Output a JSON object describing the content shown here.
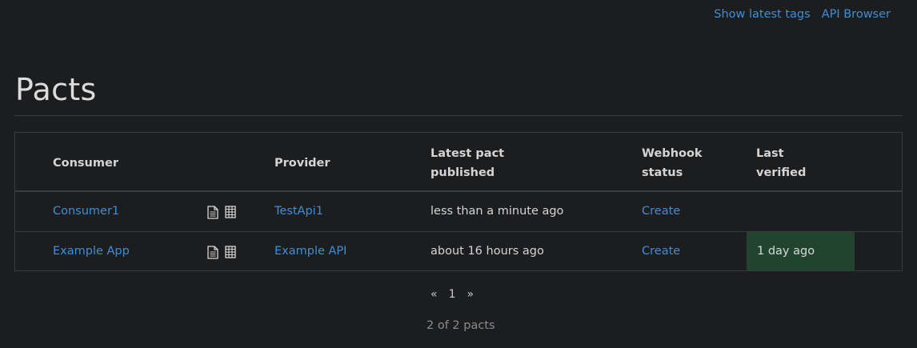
{
  "nav": {
    "show_latest_tags": "Show latest tags",
    "api_browser": "API Browser"
  },
  "page": {
    "title": "Pacts"
  },
  "table": {
    "headers": {
      "consumer": "Consumer",
      "provider": "Provider",
      "latest_pact_line1": "Latest pact",
      "latest_pact_line2": "published",
      "webhook_line1": "Webhook",
      "webhook_line2": "status",
      "verified_line1": "Last",
      "verified_line2": "verified"
    },
    "rows": [
      {
        "consumer": "Consumer1",
        "provider": "TestApi1",
        "published": "less than a minute ago",
        "webhook": "Create",
        "verified": "",
        "doc_icon": "document-icon",
        "matrix_icon": "matrix-grid-icon"
      },
      {
        "consumer": "Example App",
        "provider": "Example API",
        "published": "about 16 hours ago",
        "webhook": "Create",
        "verified": "1 day ago",
        "verified_color": "#21442e",
        "doc_icon": "document-icon",
        "matrix_icon": "matrix-grid-icon"
      }
    ]
  },
  "pagination": {
    "prev": "«",
    "current": "1",
    "next": "»"
  },
  "summary": {
    "count_text": "2 of 2 pacts"
  },
  "colors": {
    "background": "#1c1d1f",
    "link": "#3d8fd9",
    "verified_success": "#21442e",
    "border": "#3a3b3e"
  }
}
